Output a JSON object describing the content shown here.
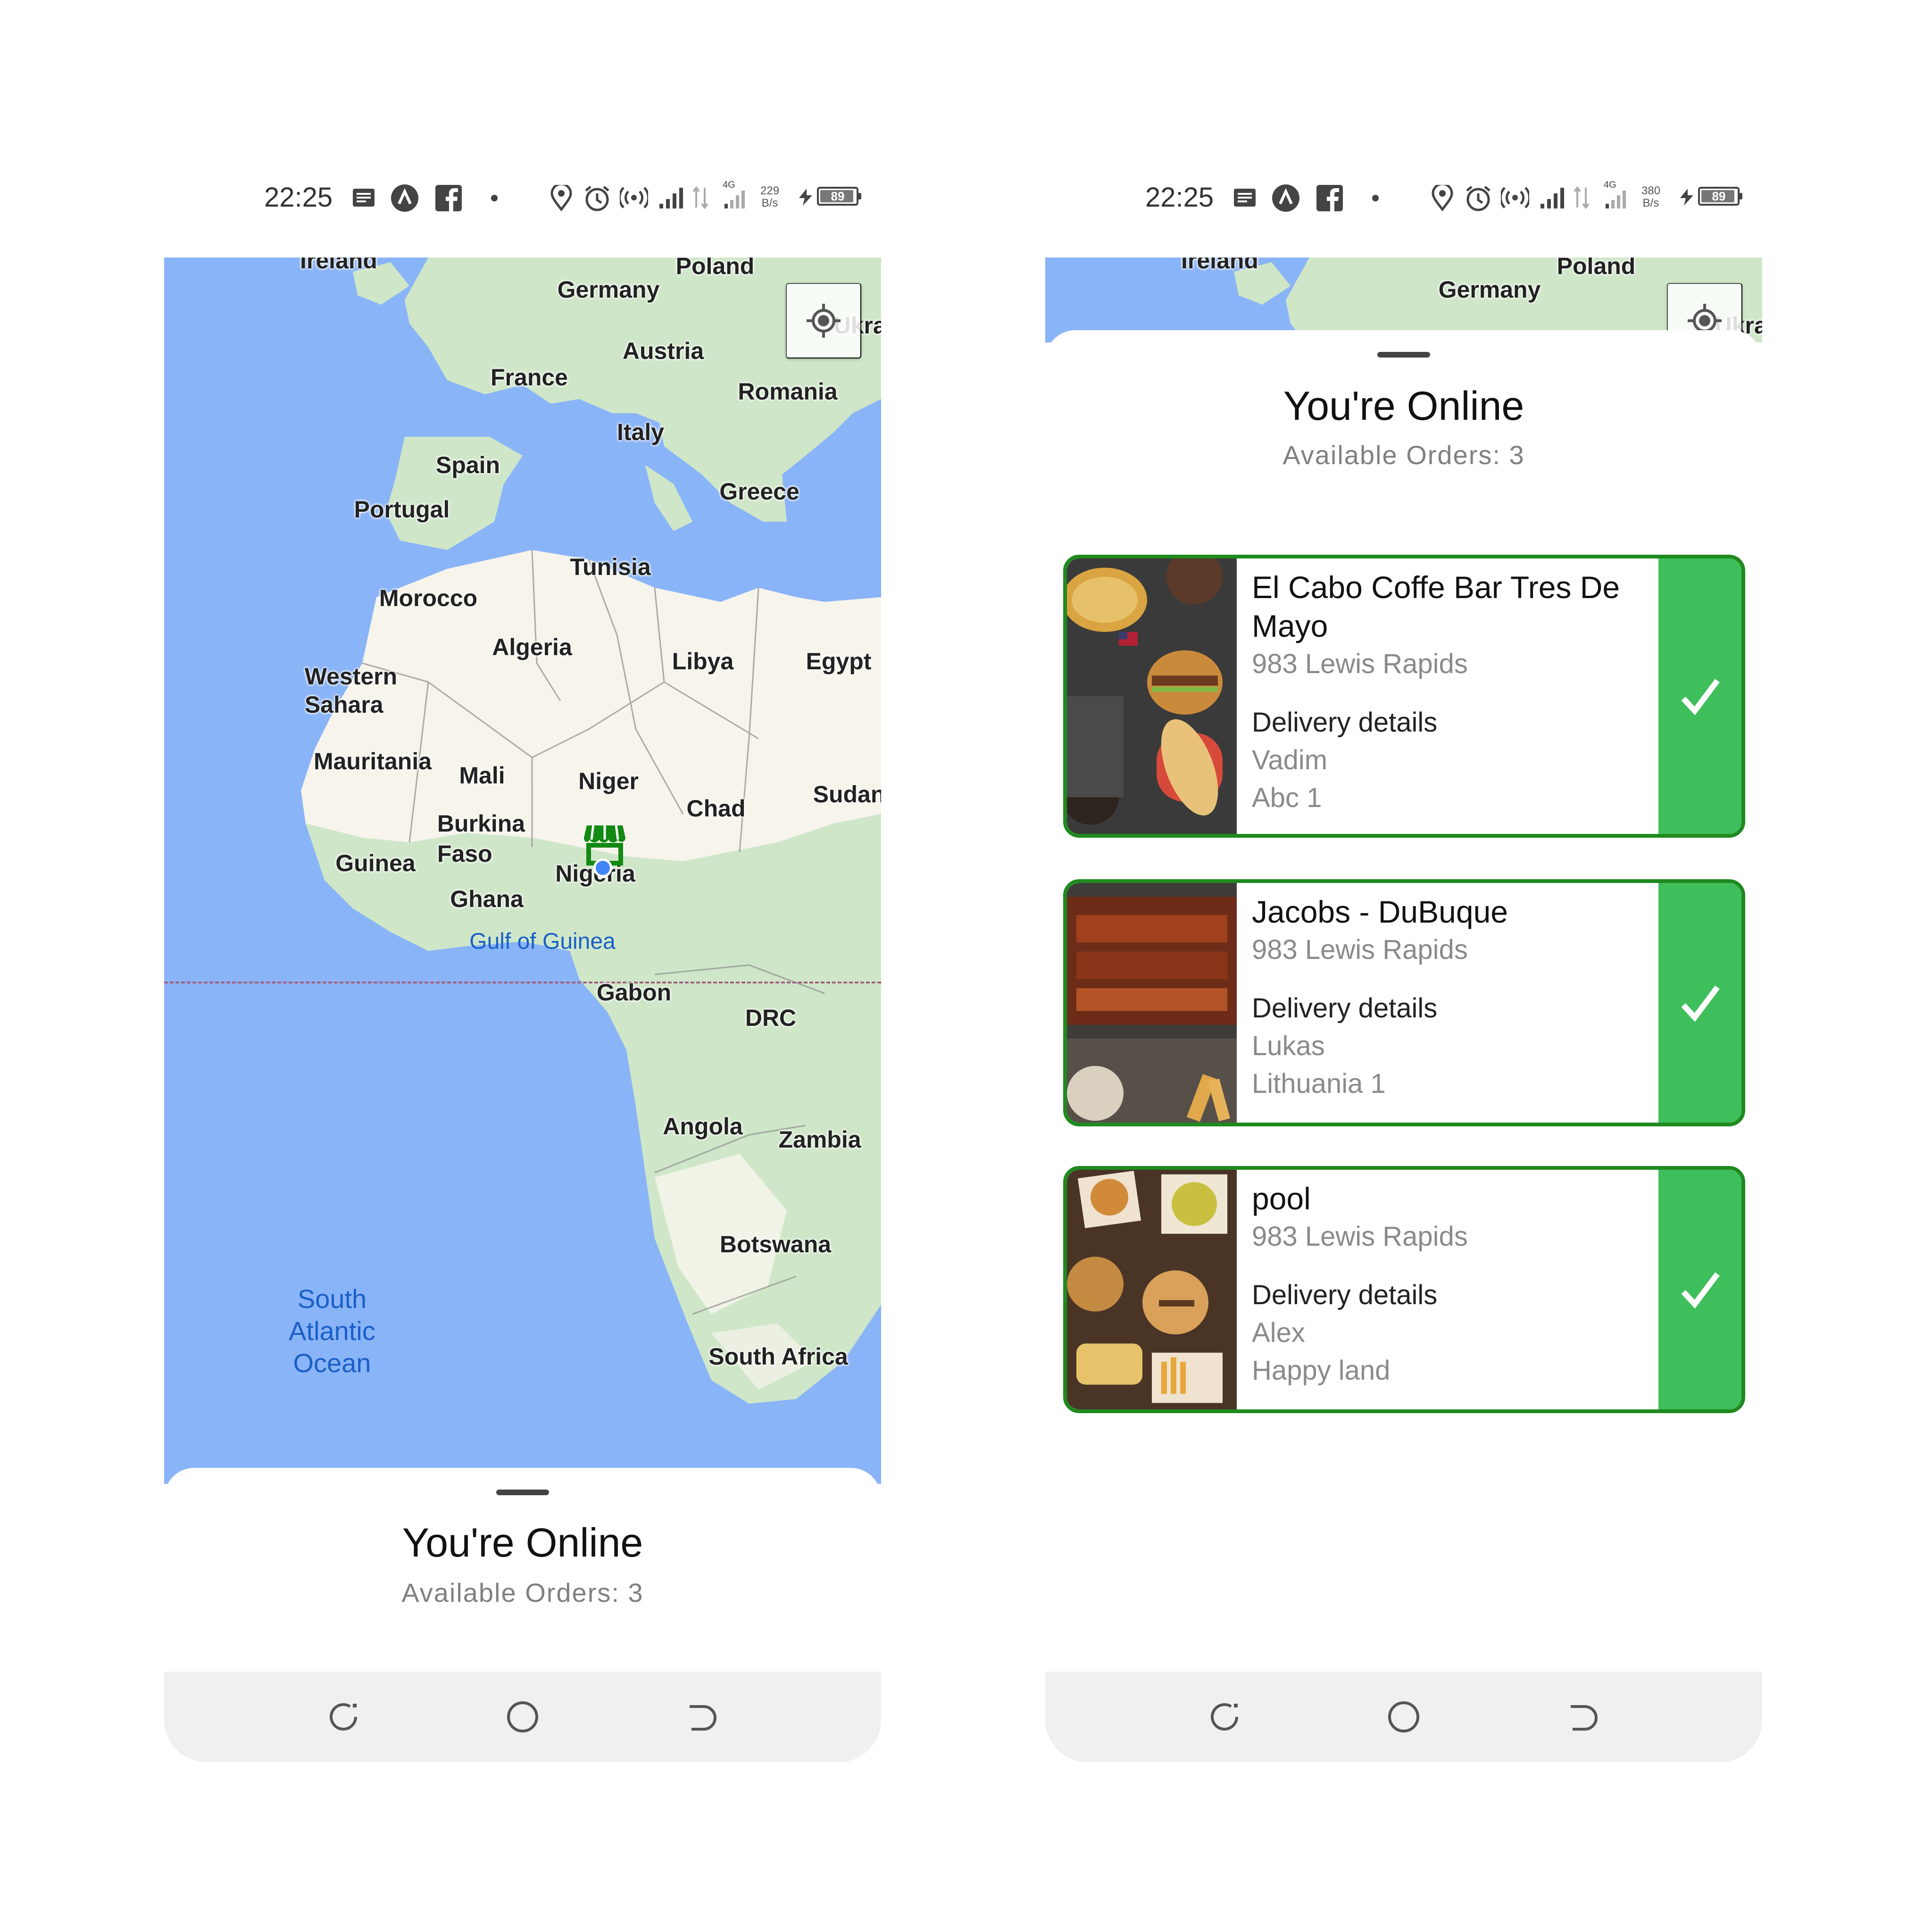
{
  "status_bar_left": {
    "time": "22:25",
    "speed_value": "229",
    "speed_unit": "B/s",
    "battery": "89",
    "network": "4G"
  },
  "status_bar_right": {
    "time": "22:25",
    "speed_value": "380",
    "speed_unit": "B/s",
    "battery": "89",
    "network": "4G"
  },
  "map": {
    "labels": {
      "ireland": "Ireland",
      "germany": "Germany",
      "poland": "Poland",
      "ukraine": "Ukrai",
      "france": "France",
      "austria": "Austria",
      "romania": "Romania",
      "italy": "Italy",
      "spain": "Spain",
      "portugal": "Portugal",
      "greece": "Greece",
      "tunisia": "Tunisia",
      "morocco": "Morocco",
      "algeria": "Algeria",
      "libya": "Libya",
      "egypt": "Egypt",
      "western_sahara": "Western\nSahara",
      "mauritania": "Mauritania",
      "mali": "Mali",
      "niger": "Niger",
      "chad": "Chad",
      "sudan": "Sudan",
      "burkina_faso": "Burkina\nFaso",
      "guinea": "Guinea",
      "ghana": "Ghana",
      "nigeria": "Nigeria",
      "gulf_of_guinea": "Gulf of Guinea",
      "gabon": "Gabon",
      "drc": "DRC",
      "angola": "Angola",
      "zambia": "Zambia",
      "botswana": "Botswana",
      "south_africa": "South Africa",
      "south_atlantic": "South\nAtlantic\nOcean"
    },
    "colors": {
      "water": "#8ab4f8",
      "land": "#cfe7c8",
      "desert": "#f7f4ec",
      "marker": "#138a13"
    }
  },
  "sheet": {
    "title": "You're Online",
    "available_orders": "Available Orders: 3"
  },
  "orders": [
    {
      "name": "El Cabo Coffe Bar Tres De Mayo",
      "address": "983 Lewis Rapids",
      "details_label": "Delivery details",
      "person": "Vadim",
      "place": "Abc 1"
    },
    {
      "name": "Jacobs - DuBuque",
      "address": "983 Lewis Rapids",
      "details_label": "Delivery details",
      "person": "Lukas",
      "place": "Lithuania 1"
    },
    {
      "name": "pool",
      "address": "983 Lewis Rapids",
      "details_label": "Delivery details",
      "person": "Alex",
      "place": "Happy land"
    }
  ],
  "colors": {
    "card_border": "#1f8a1f",
    "accept": "#3fbf5c",
    "nav_bg": "#f0f0f0"
  },
  "icons": {
    "accept": "check-icon",
    "location": "crosshair-icon",
    "store": "store-icon",
    "nav_recent": "recent-apps-icon",
    "nav_home": "home-icon",
    "nav_back": "back-icon"
  }
}
